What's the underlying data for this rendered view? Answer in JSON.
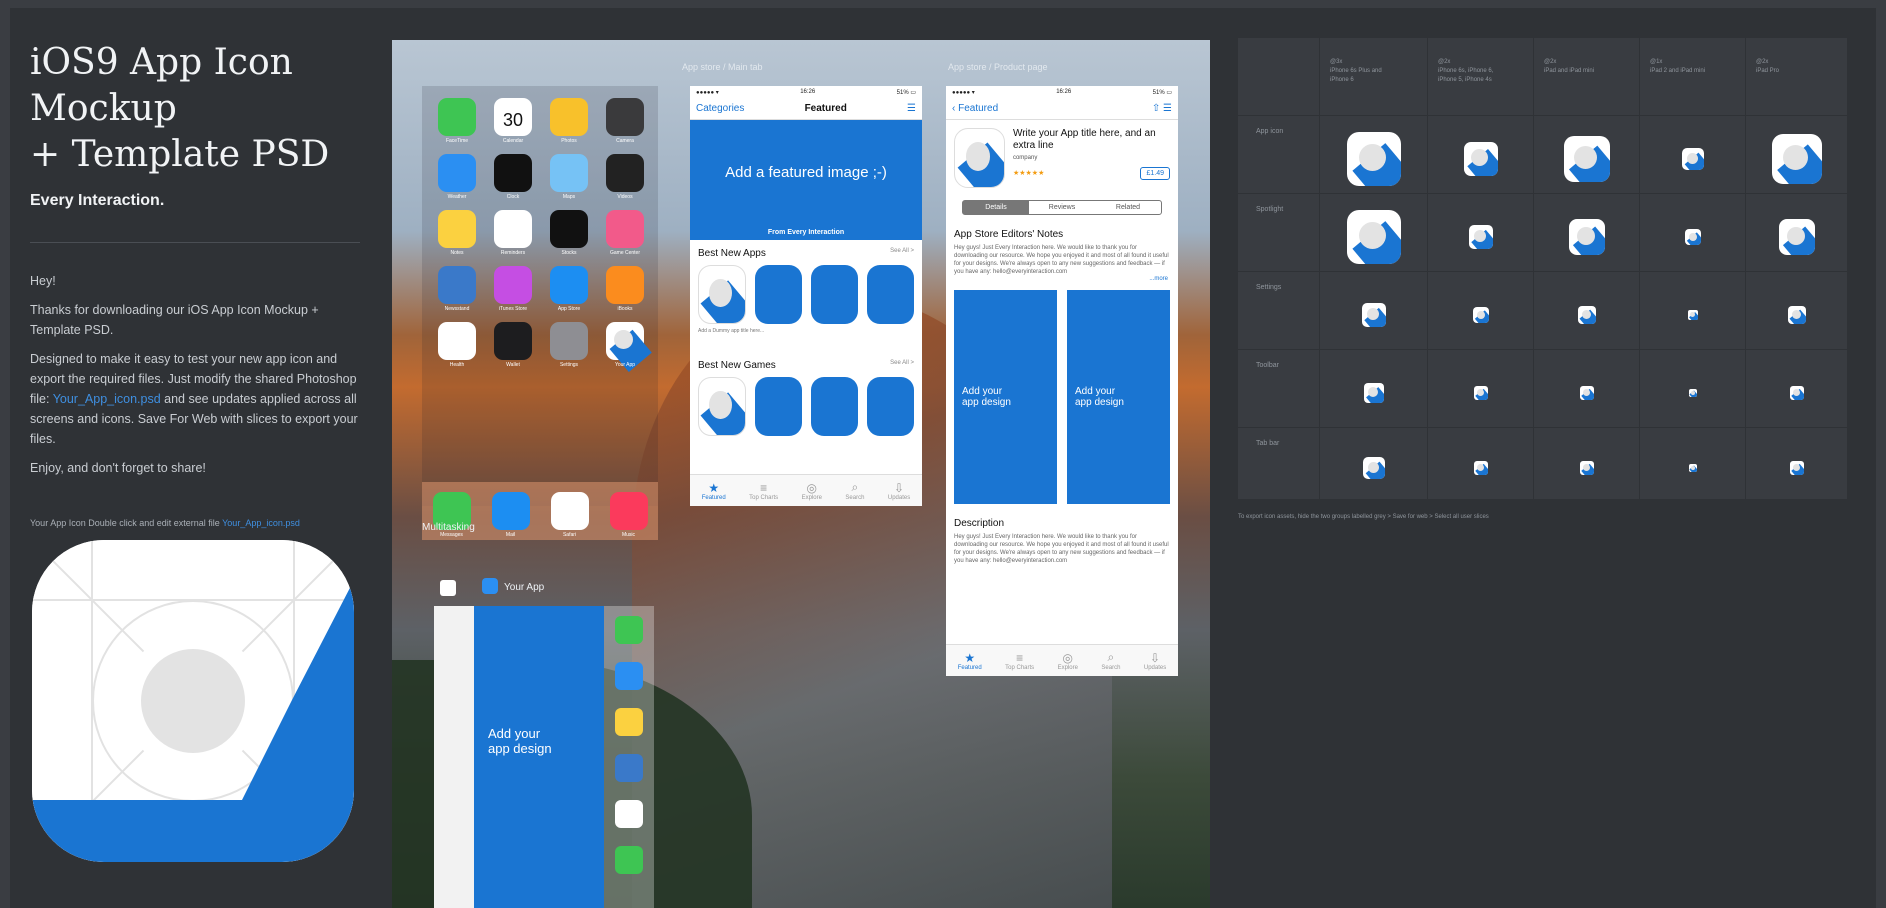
{
  "left": {
    "title": "iOS9 App Icon\nMockup\n+ Template PSD",
    "brand": "Every Interaction.",
    "greeting": "Hey!",
    "p1": "Thanks for downloading our iOS App Icon Mockup + Template PSD.",
    "p2a": "Designed to make it easy to test your new app icon and export the required files. Just modify the shared Photoshop file: ",
    "p2link": "Your_App_icon.psd",
    "p2b": " and see updates applied across all screens and icons. Save For Web with slices to export your files.",
    "p3": "Enjoy, and don't forget to share!",
    "note": "Your App Icon Double click and edit external file ",
    "note_link": "Your_App_icon.psd"
  },
  "home": {
    "apps": [
      {
        "label": "FaceTime",
        "color": "#3ec553"
      },
      {
        "label": "Calendar",
        "color": "#ffffff",
        "text": "30"
      },
      {
        "label": "Photos",
        "color": "#f8c12b"
      },
      {
        "label": "Camera",
        "color": "#3a3a3c"
      },
      {
        "label": "Weather",
        "color": "#2b8ff2"
      },
      {
        "label": "Clock",
        "color": "#111111"
      },
      {
        "label": "Maps",
        "color": "#76c2f5"
      },
      {
        "label": "Videos",
        "color": "#222222"
      },
      {
        "label": "Notes",
        "color": "#fbd140"
      },
      {
        "label": "Reminders",
        "color": "#ffffff"
      },
      {
        "label": "Stocks",
        "color": "#111111"
      },
      {
        "label": "Game Center",
        "color": "#f25a8a"
      },
      {
        "label": "Newsstand",
        "color": "#3a79c9"
      },
      {
        "label": "iTunes Store",
        "color": "#c54ee3"
      },
      {
        "label": "App Store",
        "color": "#1c8ef2"
      },
      {
        "label": "iBooks",
        "color": "#fb8c1e"
      },
      {
        "label": "Health",
        "color": "#ffffff"
      },
      {
        "label": "Wallet",
        "color": "#1d1d1f"
      },
      {
        "label": "Settings",
        "color": "#8e8e93"
      },
      {
        "label": "Your App",
        "color": "#ffffff"
      }
    ],
    "dock": [
      {
        "label": "Messages",
        "color": "#3ec553"
      },
      {
        "label": "Mail",
        "color": "#1c8ef2"
      },
      {
        "label": "Safari",
        "color": "#ffffff"
      },
      {
        "label": "Music",
        "color": "#fb3a5c"
      }
    ],
    "multitasking": "Multitasking",
    "your_app": "Your App",
    "add_design": "Add your\napp design"
  },
  "captions": {
    "phone2": "App store / Main tab",
    "phone3": "App store / Product page"
  },
  "featured": {
    "status_left": "●●●●● ▾",
    "status_time": "16:26",
    "status_right": "51% ▭",
    "nav_left": "Categories",
    "nav_title": "Featured",
    "hero_text": "Add a featured image ;-)",
    "hero_sub": "From Every Interaction",
    "section1": "Best New Apps",
    "section2": "Best New Games",
    "see_all": "See All >",
    "tile_caption": "Add a Dummy app title here...",
    "tile_price": "Category\n£1.49",
    "tabs": [
      "Featured",
      "Top Charts",
      "Explore",
      "Search",
      "Updates"
    ]
  },
  "detail": {
    "nav_left": "‹ Featured",
    "title": "Write your App title here, and an extra line",
    "company": "company",
    "price": "£1.49",
    "seg": [
      "Details",
      "Reviews",
      "Related"
    ],
    "editors": "App Store Editors' Notes",
    "editors_body": "Hey guys! Just Every Interaction here. We would like to thank you for downloading our resource. We hope you enjoyed it and most of all found it useful for your designs. We're always open to any new suggestions and feedback — if you have any: hello@everyinteraction.com",
    "more": "...more",
    "add_design": "Add your\napp design",
    "description": "Description",
    "desc_body": "Hey guys! Just Every Interaction here. We would like to thank you for downloading our resource. We hope you enjoyed it and most of all found it useful for your designs. We're always open to any new suggestions and feedback — if you have any: hello@everyinteraction.com"
  },
  "table": {
    "columns": [
      "@3x\niPhone 6s Plus and\niPhone 6",
      "@2x\niPhone 6s, iPhone 6,\niPhone 5, iPhone 4s",
      "@2x\niPad and iPad mini",
      "@1x\niPad 2 and iPad mini",
      "@2x\niPad Pro"
    ],
    "rows": [
      "App icon",
      "Spotlight",
      "Settings",
      "Toolbar",
      "Tab bar"
    ],
    "footnote": "To export icon assets, hide the two groups labelled grey > Save for web > Select all user slices"
  }
}
